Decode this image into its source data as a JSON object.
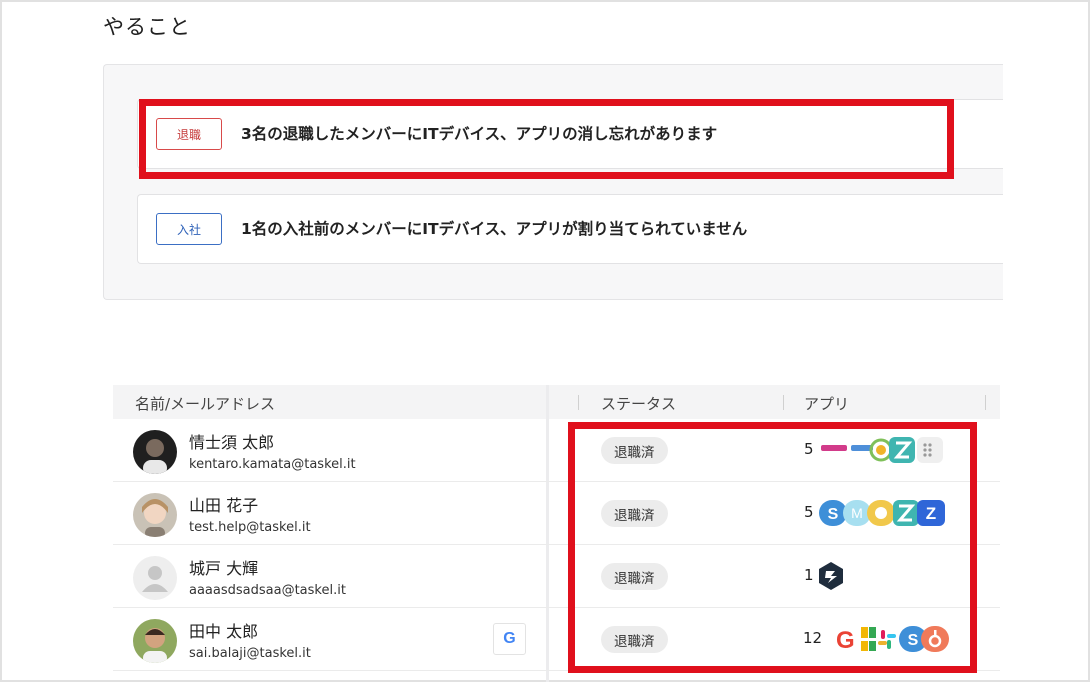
{
  "page_title": "やること",
  "todos": [
    {
      "badge": "退職",
      "text": "3名の退職したメンバーにITデバイス、アプリの消し忘れがあります",
      "badge_color": "#d84a4a"
    },
    {
      "badge": "入社",
      "text": "1名の入社前のメンバーにITデバイス、アプリが割り当てられていません",
      "badge_color": "#3b6fc4"
    }
  ],
  "table": {
    "columns": [
      "名前/メールアドレス",
      "ステータス",
      "アプリ"
    ],
    "rows": [
      {
        "name": "情士須 太郎",
        "email": "kentaro.kamata@taskel.it",
        "status": "退職済",
        "app_count": "5",
        "icons": [
          "small-logos-icon",
          "s-app-icon",
          "zendesk-icon",
          "grid-icon"
        ]
      },
      {
        "name": "山田 花子",
        "email": "test.help@taskel.it",
        "status": "退職済",
        "app_count": "5",
        "icons": [
          "s-app-icon",
          "m-app-icon",
          "zendesk-icon",
          "z-app-icon"
        ]
      },
      {
        "name": "城戸 大輝",
        "email": "aaaasdsadsaa@taskel.it",
        "status": "退職済",
        "app_count": "1",
        "icons": [
          "dark-app-icon"
        ]
      },
      {
        "name": "田中 太郎",
        "email": "sai.balaji@taskel.it",
        "status": "退職済",
        "app_count": "12",
        "google_badge": "G",
        "icons": [
          "google-icon",
          "sheets-icon",
          "slack-icon",
          "s-app-icon",
          "hubspot-icon"
        ]
      }
    ]
  },
  "colors": {
    "highlight": "#e0101c",
    "retire_badge": "#d84a4a",
    "join_badge": "#3b6fc4"
  }
}
